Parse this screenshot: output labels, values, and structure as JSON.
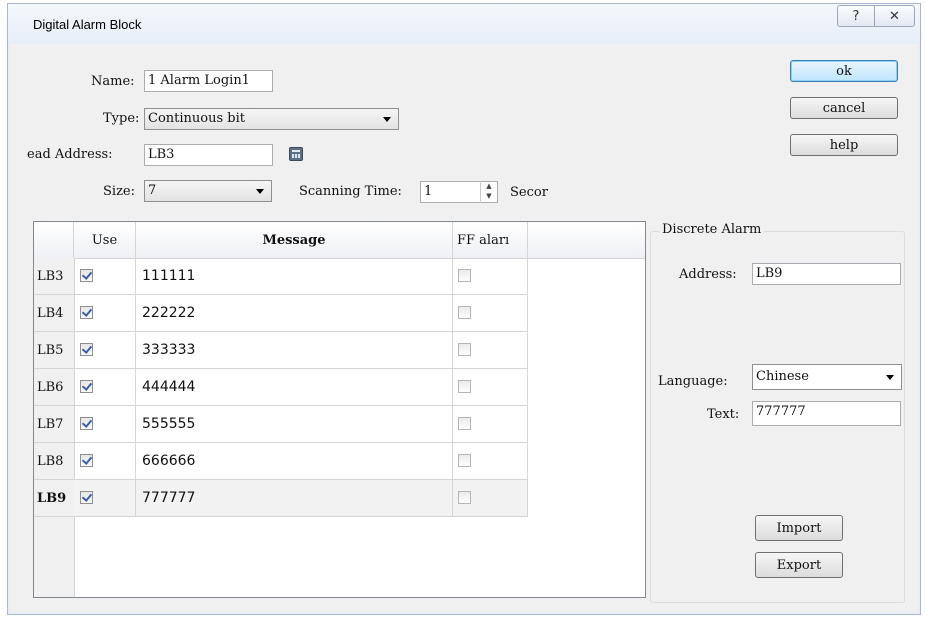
{
  "window": {
    "title": "Digital Alarm Block",
    "help_glyph": "?",
    "close_glyph": "✕"
  },
  "form": {
    "name_label": "Name:",
    "name_value": "1 Alarm Login1",
    "type_label": "Type:",
    "type_value": "Continuous bit",
    "read_address_label": "ead Address:",
    "read_address_value": "LB3",
    "size_label": "Size:",
    "size_value": "7",
    "scanning_time_label": "Scanning Time:",
    "scanning_time_value": "1",
    "scanning_unit": "Secor"
  },
  "buttons": {
    "ok": "ok",
    "cancel": "cancel",
    "help": "help",
    "import": "Import",
    "export": "Export"
  },
  "grid": {
    "headers": {
      "use": "Use",
      "message": "Message",
      "ff_alarm": "FF aları"
    },
    "rows": [
      {
        "label": "LB3",
        "use": true,
        "message": "111111",
        "ff": false
      },
      {
        "label": "LB4",
        "use": true,
        "message": "222222",
        "ff": false
      },
      {
        "label": "LB5",
        "use": true,
        "message": "333333",
        "ff": false
      },
      {
        "label": "LB6",
        "use": true,
        "message": "444444",
        "ff": false
      },
      {
        "label": "LB7",
        "use": true,
        "message": "555555",
        "ff": false
      },
      {
        "label": "LB8",
        "use": true,
        "message": "666666",
        "ff": false
      },
      {
        "label": "LB9",
        "use": true,
        "message": "777777",
        "ff": false,
        "selected": true
      }
    ]
  },
  "discrete": {
    "title": "Discrete Alarm",
    "address_label": "Address:",
    "address_value": "LB9",
    "language_label": "Language:",
    "language_value": "Chinese",
    "text_label": "Text:",
    "text_value": "777777"
  }
}
